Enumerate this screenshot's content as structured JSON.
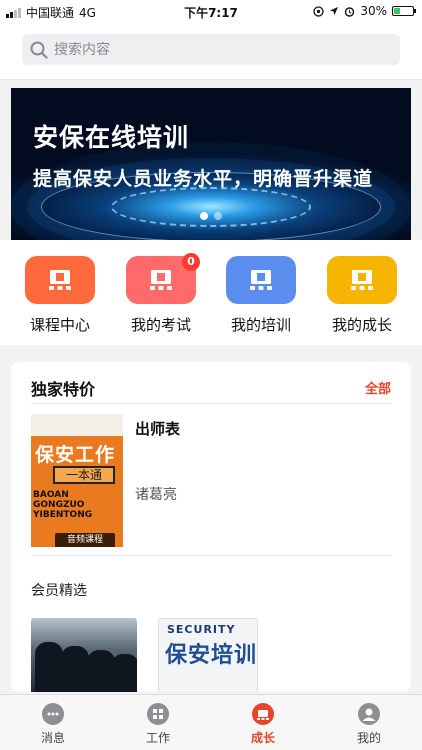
{
  "status_bar": {
    "carrier": "中国联通",
    "network": "4G",
    "time": "下午7:17",
    "battery": "30%"
  },
  "search": {
    "placeholder": "搜索内容"
  },
  "banner": {
    "title": "安保在线培训",
    "subtitle": "提高保安人员业务水平，明确晋升渠道",
    "slide_count": 2,
    "active_slide": 1
  },
  "quick_actions": [
    {
      "label": "课程中心",
      "color": "#ff6a3d",
      "icon": "monitor-icon"
    },
    {
      "label": "我的考试",
      "color": "#ff6b6b",
      "icon": "monitor-icon",
      "badge": "0"
    },
    {
      "label": "我的培训",
      "color": "#5b8def",
      "icon": "monitor-icon"
    },
    {
      "label": "我的成长",
      "color": "#f5b400",
      "icon": "monitor-icon"
    }
  ],
  "section": {
    "title": "独家特价",
    "more": "全部"
  },
  "course": {
    "name": "出师表",
    "author": "诸葛亮",
    "cover_title": "保安工作",
    "cover_box": "一本通",
    "cover_en": "BAOAN GONGZUO YIBENTONG",
    "cover_tag": "音频课程"
  },
  "member": {
    "title": "会员精选",
    "cover2_en": "SECURITY",
    "cover2_title": "保安培训"
  },
  "tabbar": [
    {
      "label": "消息",
      "icon": "message-icon",
      "active": false
    },
    {
      "label": "工作",
      "icon": "grid-icon",
      "active": false
    },
    {
      "label": "成长",
      "icon": "growth-icon",
      "active": true
    },
    {
      "label": "我的",
      "icon": "user-icon",
      "active": false
    }
  ],
  "colors": {
    "accent": "#e8442c"
  }
}
